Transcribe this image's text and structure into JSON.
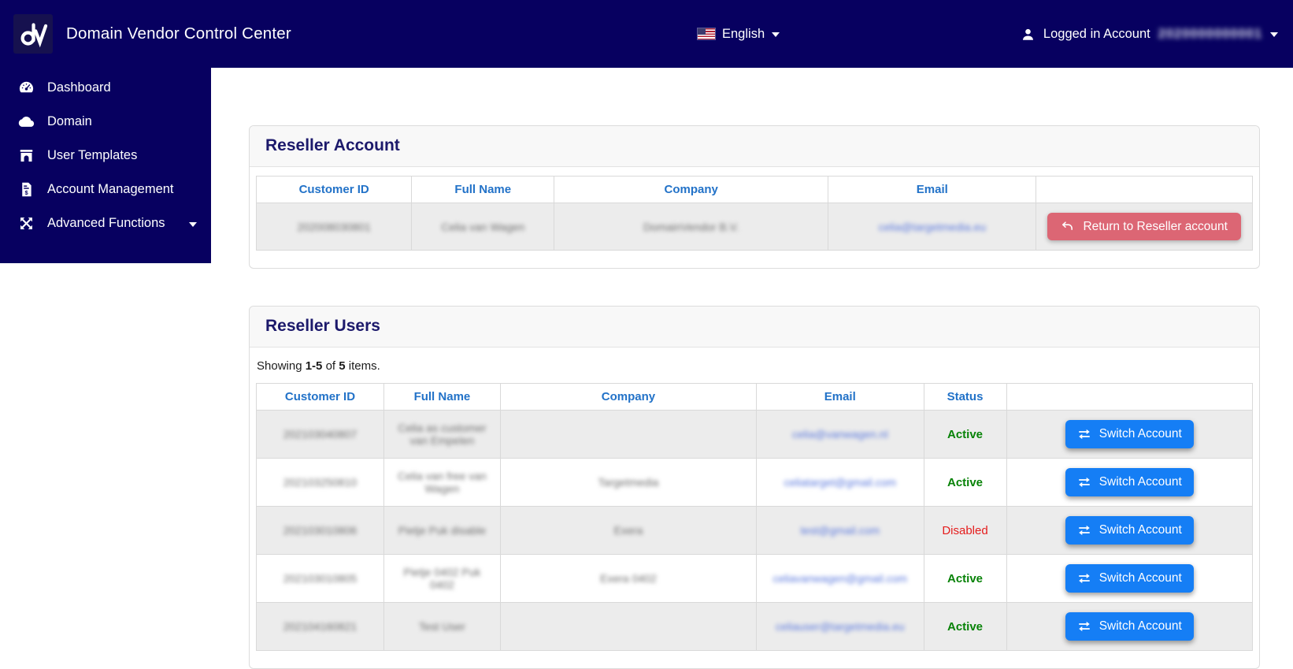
{
  "header": {
    "app_title": "Domain Vendor Control Center",
    "language_label": "English",
    "account_label": "Logged in Account",
    "account_number_redacted": "2020000000001"
  },
  "sidebar": {
    "items": [
      {
        "label": "Dashboard",
        "icon": "gauge-icon"
      },
      {
        "label": "Domain",
        "icon": "cloud-icon"
      },
      {
        "label": "User Templates",
        "icon": "archway-icon"
      },
      {
        "label": "Account Management",
        "icon": "invoice-icon"
      },
      {
        "label": "Advanced Functions",
        "icon": "expand-arrows-icon",
        "has_submenu": true
      }
    ]
  },
  "reseller_account": {
    "title": "Reseller Account",
    "columns": [
      "Customer ID",
      "Full Name",
      "Company",
      "Email",
      ""
    ],
    "row": {
      "redacted": true,
      "customer_id": "202008030801",
      "full_name": "Celia van Wagen",
      "company": "DomainVendor B.V.",
      "email": "celia@targetmedia.eu"
    },
    "return_button_label": "Return to Reseller account"
  },
  "reseller_users": {
    "title": "Reseller Users",
    "summary": {
      "showing": "Showing",
      "range": "1-5",
      "of": "of",
      "total": "5",
      "items": "items."
    },
    "columns": [
      "Customer ID",
      "Full Name",
      "Company",
      "Email",
      "Status",
      ""
    ],
    "switch_button_label": "Switch Account",
    "rows_redacted": true,
    "rows": [
      {
        "customer_id": "202103040807",
        "full_name": "Celia as customer van Empelen",
        "company": "",
        "email": "celia@vanwagen.nl",
        "status": "Active"
      },
      {
        "customer_id": "202103250810",
        "full_name": "Celia van free van Wagen",
        "company": "Targetmedia",
        "email": "celiatarget@gmail.com",
        "status": "Active"
      },
      {
        "customer_id": "202103010806",
        "full_name": "Pietje Puk disable",
        "company": "Exera",
        "email": "test@gmail.com",
        "status": "Disabled"
      },
      {
        "customer_id": "202103010805",
        "full_name": "Pietje 0402 Puk 0402",
        "company": "Exera 0402",
        "email": "celiavanwagen@gmail.com",
        "status": "Active"
      },
      {
        "customer_id": "202104160821",
        "full_name": "Test User",
        "company": "",
        "email": "celiauser@targetmedia.eu",
        "status": "Active"
      }
    ]
  },
  "icons": {
    "logo": "dv-logo",
    "language_flag": "us-flag-icon",
    "account": "person-icon",
    "dropdowns": "caret-down-icon",
    "switch_button": "exchange-arrows-icon",
    "return_button": "undo-arrow-icon"
  },
  "colors": {
    "navy": "#070060",
    "card_title_navy": "#1c196b",
    "table_header_blue": "#2272c8",
    "active_green": "#078207",
    "disabled_red": "#e51c1c",
    "switch_button_blue": "#157ef5",
    "return_button_red": "#dc6674",
    "striped_row_gray": "#ececec"
  }
}
